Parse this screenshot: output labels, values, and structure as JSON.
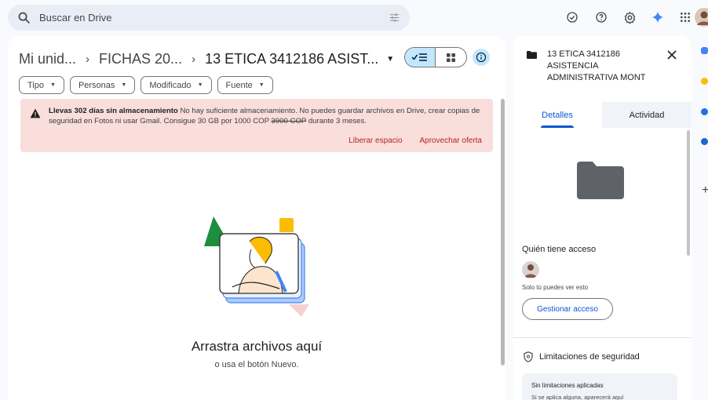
{
  "search": {
    "placeholder": "Buscar en Drive",
    "icon": "search-icon",
    "filter_icon": "tune-icon"
  },
  "topbar": {
    "icons": [
      "offline-status-icon",
      "help-icon",
      "settings-icon",
      "gemini-icon",
      "apps-icon",
      "avatar"
    ]
  },
  "breadcrumb": {
    "items": [
      "Mi unid...",
      "FICHAS 20...",
      "13 ETICA 3412186 ASIST..."
    ]
  },
  "filters": [
    {
      "label": "Tipo"
    },
    {
      "label": "Personas"
    },
    {
      "label": "Modificado"
    },
    {
      "label": "Fuente"
    }
  ],
  "banner": {
    "bold": "Llevas 302 días sin almacenamiento",
    "text_1": " No hay suficiente almacenamiento. No puedes guardar archivos en Drive, crear copias de seguridad en Fotos ni usar Gmail. Consigue 30 GB por 1000 COP ",
    "old_price": "3900 COP",
    "text_2": " durante 3 meses.",
    "action_free": "Liberar espacio",
    "action_offer": "Aprovechar oferta",
    "color": "#f9dedc"
  },
  "empty_state": {
    "title": "Arrastra archivos aquí",
    "subtitle": "o usa el botón Nuevo."
  },
  "details": {
    "title": "13 ETICA 3412186 ASISTENCIA ADMINISTRATIVA MONT",
    "tabs": [
      "Detalles",
      "Actividad"
    ],
    "active_tab": "Detalles",
    "access_heading": "Quién tiene acceso",
    "access_note": "Solo tú puedes ver esto",
    "manage_button": "Gestionar acceso",
    "security_heading": "Limitaciones de seguridad",
    "security_card_title": "Sin limitaciones aplicadas",
    "security_card_text": "Si se aplica alguna, aparecerá aquí"
  },
  "colors": {
    "accent": "#0b57d0",
    "selected_toggle": "#c2e7ff",
    "background": "#f8fafd"
  }
}
